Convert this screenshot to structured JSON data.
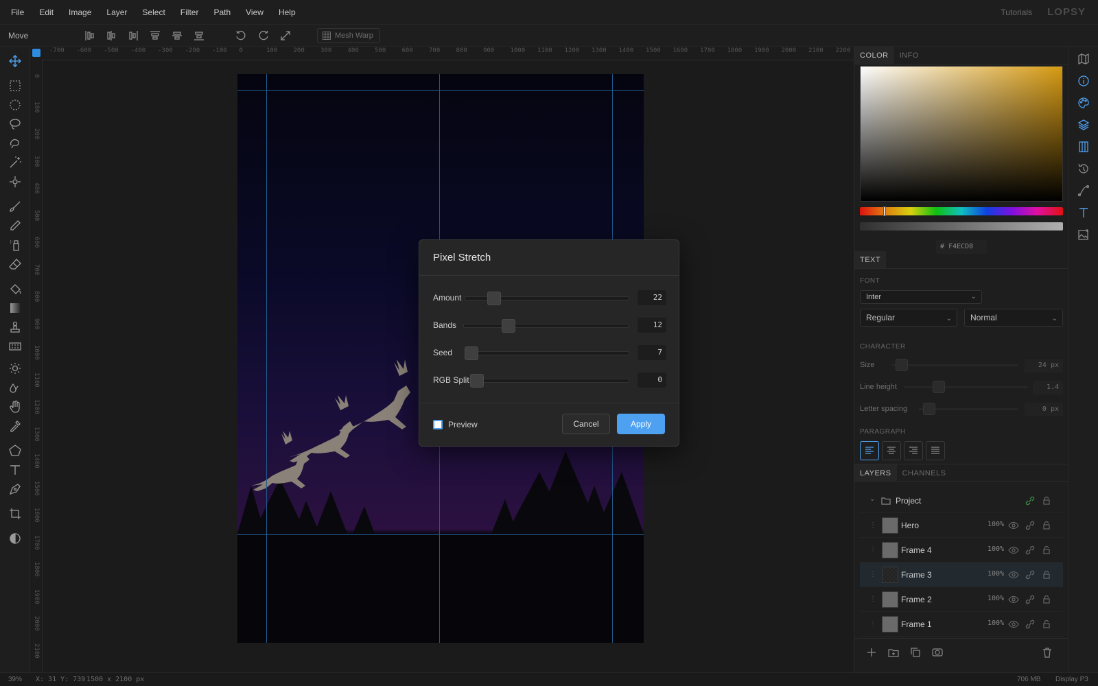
{
  "menu": [
    "File",
    "Edit",
    "Image",
    "Layer",
    "Select",
    "Filter",
    "Path",
    "View",
    "Help"
  ],
  "header": {
    "tutorials": "Tutorials",
    "logo": "LOPSY"
  },
  "tool_options": {
    "tool_name": "Move",
    "mesh_warp": "Mesh Warp"
  },
  "ruler": {
    "top": [
      "-700",
      "-600",
      "-500",
      "-400",
      "-300",
      "-200",
      "-100",
      "0",
      "100",
      "200",
      "300",
      "400",
      "500",
      "600",
      "700",
      "800",
      "900",
      "1000",
      "1100",
      "1200",
      "1300",
      "1400",
      "1500",
      "1600",
      "1700",
      "1800",
      "1900",
      "2000",
      "2100",
      "2200"
    ],
    "left": [
      "0",
      "100",
      "200",
      "300",
      "400",
      "500",
      "600",
      "700",
      "800",
      "900",
      "1000",
      "1100",
      "1200",
      "1300",
      "1400",
      "1500",
      "1600",
      "1700",
      "1800",
      "1900",
      "2000",
      "2100"
    ]
  },
  "dialog": {
    "title": "Pixel Stretch",
    "sliders": [
      {
        "label": "Amount",
        "value": "22",
        "fraction": 0.15
      },
      {
        "label": "Bands",
        "value": "12",
        "fraction": 0.23
      },
      {
        "label": "Seed",
        "value": "7",
        "fraction": 0.02
      },
      {
        "label": "RGB Split",
        "value": "0",
        "fraction": 0.0
      }
    ],
    "preview_label": "Preview",
    "preview_checked": true,
    "cancel": "Cancel",
    "apply": "Apply"
  },
  "panel": {
    "color_tabs": [
      "COLOR",
      "INFO"
    ],
    "hex_prefix": "#",
    "hex": "F4ECD8",
    "text_tab": "TEXT",
    "font_label": "FONT",
    "font_family": "Inter",
    "font_weight": "Regular",
    "font_style": "Normal",
    "character_label": "CHARACTER",
    "character": [
      {
        "label": "Size",
        "value": "24 px"
      },
      {
        "label": "Line height",
        "value": "1.4"
      },
      {
        "label": "Letter spacing",
        "value": "0 px"
      }
    ],
    "paragraph_label": "PARAGRAPH",
    "layer_tabs": [
      "LAYERS",
      "CHANNELS"
    ],
    "group": "Project",
    "layers": [
      {
        "name": "Hero",
        "opacity": "100%",
        "selected": false
      },
      {
        "name": "Frame 4",
        "opacity": "100%",
        "selected": false
      },
      {
        "name": "Frame 3",
        "opacity": "100%",
        "selected": true
      },
      {
        "name": "Frame 2",
        "opacity": "100%",
        "selected": false
      },
      {
        "name": "Frame 1",
        "opacity": "100%",
        "selected": false
      }
    ]
  },
  "status": {
    "zoom": "39%",
    "coords": "X: 31 Y: 739",
    "doc_size": "1500 x 2100 px",
    "memory": "706 MB",
    "display": "Display P3"
  },
  "colors": {
    "accent": "#4ea1f1",
    "hex_swatch": "#F4ECD8"
  }
}
